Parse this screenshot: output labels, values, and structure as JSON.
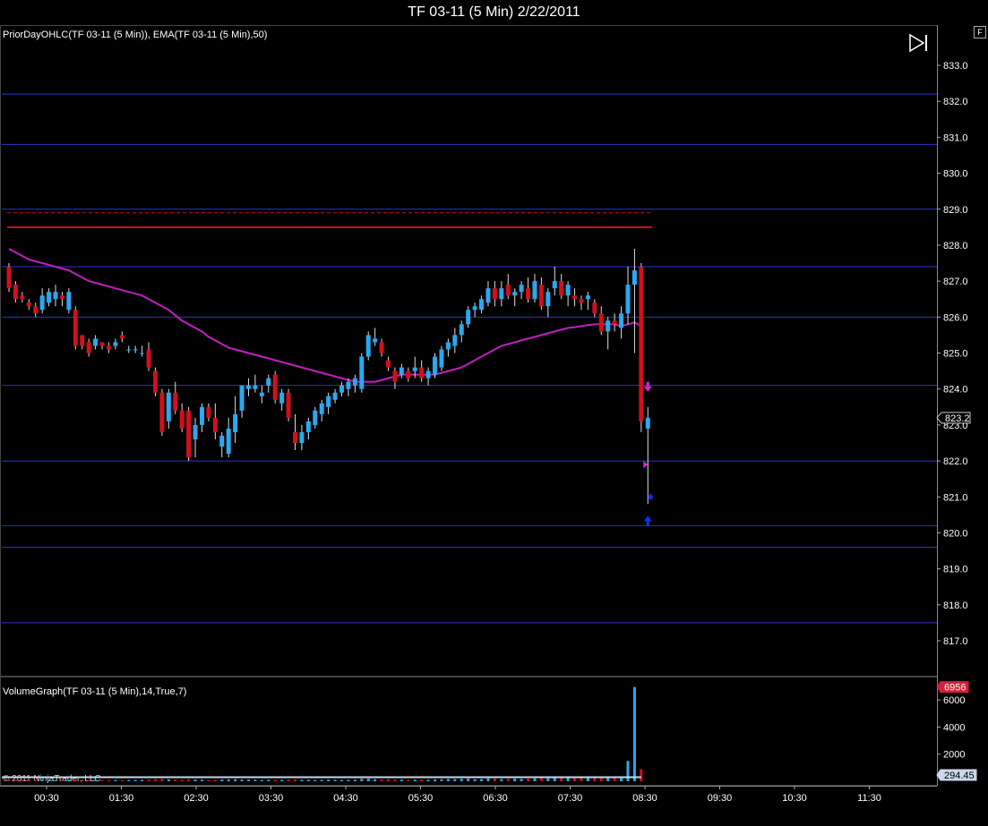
{
  "title": "TF 03-11 (5 Min)  2/22/2011",
  "price_panel_label": "PriorDayOHLC(TF 03-11 (5 Min)), EMA(TF 03-11 (5 Min),50)",
  "volume_panel_label": "VolumeGraph(TF 03-11 (5 Min),14,True,7)",
  "copyright": "© 2011 NinjaTrader, LLC",
  "f_button": "F",
  "colors": {
    "up": "#2aa8f0",
    "down": "#d0101c",
    "ema": "#c020c0",
    "hline": "#2a36c8",
    "prior_day": "#d41010",
    "axis_text": "#ffffff",
    "marker_magenta": "#e020e0",
    "marker_blue": "#1030f0"
  },
  "chart_data": [
    {
      "type": "candlestick",
      "panel": "price",
      "yaxis": {
        "min": 816.0,
        "max": 833.5,
        "ticks": [
          "833.0",
          "832.0",
          "831.0",
          "830.0",
          "829.0",
          "828.0",
          "827.0",
          "826.0",
          "825.0",
          "824.0",
          "823.0",
          "822.0",
          "821.0",
          "820.0",
          "819.0",
          "818.0",
          "817.0"
        ]
      },
      "xaxis": {
        "ticks": [
          "00:30",
          "01:30",
          "02:30",
          "03:30",
          "04:30",
          "05:30",
          "06:30",
          "07:30",
          "08:30",
          "09:30",
          "10:30",
          "11:30"
        ]
      },
      "last_price": "823.2",
      "horizontal_lines": [
        832.2,
        830.8,
        829.0,
        827.4,
        826.0,
        824.1,
        822.0,
        820.2,
        819.6,
        817.5
      ],
      "prior_day_lines": [
        {
          "y": 828.9,
          "style": "dashed"
        },
        {
          "y": 828.5,
          "style": "solid"
        }
      ],
      "candles": [
        [
          827.4,
          827.5,
          826.7,
          826.8
        ],
        [
          826.9,
          827.0,
          826.4,
          826.5
        ],
        [
          826.6,
          826.7,
          826.4,
          826.5
        ],
        [
          826.4,
          826.5,
          826.2,
          826.3
        ],
        [
          826.3,
          826.4,
          826.0,
          826.1
        ],
        [
          826.2,
          826.8,
          826.1,
          826.6
        ],
        [
          826.4,
          826.8,
          826.3,
          826.7
        ],
        [
          826.5,
          826.9,
          826.3,
          826.7
        ],
        [
          826.6,
          826.7,
          826.3,
          826.5
        ],
        [
          826.2,
          826.8,
          826.1,
          826.7
        ],
        [
          826.2,
          826.3,
          825.1,
          825.2
        ],
        [
          825.5,
          825.5,
          825.1,
          825.2
        ],
        [
          825.3,
          825.4,
          824.9,
          825.0
        ],
        [
          825.2,
          825.5,
          825.1,
          825.4
        ],
        [
          825.3,
          825.3,
          825.1,
          825.2
        ],
        [
          825.2,
          825.3,
          825.0,
          825.1
        ],
        [
          825.2,
          825.4,
          825.1,
          825.3
        ],
        [
          825.5,
          825.6,
          825.3,
          825.4
        ],
        [
          825.1,
          825.2,
          825.0,
          825.1
        ],
        [
          825.1,
          825.2,
          825.0,
          825.1
        ],
        [
          825.0,
          825.2,
          824.9,
          825.0
        ],
        [
          825.1,
          825.3,
          824.5,
          824.6
        ],
        [
          824.5,
          824.6,
          823.8,
          823.9
        ],
        [
          823.9,
          824.0,
          822.7,
          822.8
        ],
        [
          823.1,
          824.0,
          822.9,
          823.9
        ],
        [
          823.9,
          824.2,
          823.3,
          823.4
        ],
        [
          823.4,
          823.6,
          822.8,
          822.9
        ],
        [
          823.4,
          823.5,
          822.0,
          822.1
        ],
        [
          822.6,
          823.2,
          822.1,
          823.0
        ],
        [
          823.0,
          823.6,
          822.8,
          823.5
        ],
        [
          823.5,
          823.6,
          823.1,
          823.2
        ],
        [
          823.2,
          823.6,
          822.6,
          822.8
        ],
        [
          822.4,
          822.8,
          822.1,
          822.7
        ],
        [
          822.2,
          823.2,
          822.1,
          822.9
        ],
        [
          822.8,
          823.8,
          822.5,
          823.3
        ],
        [
          823.4,
          824.1,
          823.2,
          824.1
        ],
        [
          824.0,
          824.3,
          823.8,
          824.1
        ],
        [
          824.0,
          824.4,
          823.9,
          824.1
        ],
        [
          823.8,
          824.1,
          823.6,
          823.9
        ],
        [
          824.1,
          824.4,
          823.9,
          824.3
        ],
        [
          824.4,
          824.5,
          823.6,
          823.7
        ],
        [
          823.6,
          824.0,
          823.4,
          823.9
        ],
        [
          823.9,
          824.0,
          823.1,
          823.2
        ],
        [
          822.8,
          823.3,
          822.3,
          822.5
        ],
        [
          822.5,
          823.0,
          822.3,
          822.8
        ],
        [
          822.8,
          823.2,
          822.6,
          823.1
        ],
        [
          823.0,
          823.5,
          822.9,
          823.4
        ],
        [
          823.3,
          823.7,
          823.1,
          823.6
        ],
        [
          823.5,
          823.9,
          823.3,
          823.8
        ],
        [
          823.7,
          824.0,
          823.6,
          823.9
        ],
        [
          823.9,
          824.2,
          823.8,
          824.1
        ],
        [
          824.0,
          824.3,
          823.8,
          824.2
        ],
        [
          824.1,
          824.4,
          823.9,
          824.3
        ],
        [
          824.0,
          825.0,
          823.9,
          824.9
        ],
        [
          824.9,
          825.6,
          824.8,
          825.5
        ],
        [
          825.3,
          825.7,
          825.2,
          825.4
        ],
        [
          825.3,
          825.4,
          824.9,
          825.0
        ],
        [
          824.8,
          824.9,
          824.5,
          824.6
        ],
        [
          824.5,
          824.6,
          824.0,
          824.2
        ],
        [
          824.4,
          824.7,
          824.3,
          824.6
        ],
        [
          824.5,
          824.6,
          824.2,
          824.3
        ],
        [
          824.5,
          824.9,
          824.3,
          824.6
        ],
        [
          824.6,
          824.8,
          824.2,
          824.3
        ],
        [
          824.3,
          824.6,
          824.1,
          824.5
        ],
        [
          824.4,
          825.0,
          824.3,
          824.9
        ],
        [
          824.6,
          825.2,
          824.5,
          825.1
        ],
        [
          825.1,
          825.4,
          824.9,
          825.3
        ],
        [
          825.2,
          825.7,
          825.0,
          825.5
        ],
        [
          825.5,
          825.9,
          825.3,
          825.8
        ],
        [
          825.8,
          826.3,
          825.7,
          826.2
        ],
        [
          826.2,
          826.4,
          826.0,
          826.3
        ],
        [
          826.2,
          826.6,
          826.1,
          826.5
        ],
        [
          826.4,
          827.0,
          826.3,
          826.8
        ],
        [
          826.8,
          827.0,
          826.3,
          826.5
        ],
        [
          826.5,
          827.0,
          826.3,
          826.8
        ],
        [
          826.9,
          827.2,
          826.5,
          826.6
        ],
        [
          826.6,
          826.8,
          826.3,
          826.7
        ],
        [
          826.7,
          827.0,
          826.5,
          826.9
        ],
        [
          826.8,
          827.1,
          826.4,
          826.5
        ],
        [
          826.5,
          827.2,
          826.4,
          827.0
        ],
        [
          826.9,
          827.1,
          826.2,
          826.3
        ],
        [
          826.3,
          826.8,
          826.0,
          826.7
        ],
        [
          826.8,
          827.4,
          826.6,
          827.0
        ],
        [
          827.0,
          827.2,
          826.5,
          826.6
        ],
        [
          826.6,
          827.0,
          826.3,
          826.9
        ],
        [
          826.6,
          826.8,
          826.3,
          826.5
        ],
        [
          826.5,
          826.6,
          826.2,
          826.4
        ],
        [
          826.5,
          826.7,
          826.2,
          826.6
        ],
        [
          826.4,
          826.5,
          826.0,
          826.1
        ],
        [
          826.1,
          826.3,
          825.5,
          825.6
        ],
        [
          825.6,
          826.0,
          825.1,
          825.9
        ],
        [
          825.9,
          826.1,
          825.6,
          825.8
        ],
        [
          825.7,
          826.3,
          825.4,
          826.1
        ],
        [
          826.1,
          827.4,
          825.8,
          826.9
        ],
        [
          826.9,
          827.9,
          825.0,
          827.3
        ],
        [
          827.4,
          827.5,
          822.8,
          823.1
        ],
        [
          822.9,
          823.5,
          820.8,
          823.2
        ]
      ],
      "ema": [
        827.9,
        827.8,
        827.7,
        827.6,
        827.55,
        827.5,
        827.45,
        827.4,
        827.35,
        827.3,
        827.2,
        827.1,
        827.0,
        826.95,
        826.9,
        826.85,
        826.8,
        826.75,
        826.7,
        826.65,
        826.6,
        826.5,
        826.4,
        826.3,
        826.2,
        826.05,
        825.9,
        825.8,
        825.7,
        825.6,
        825.45,
        825.35,
        825.25,
        825.15,
        825.1,
        825.05,
        825.0,
        824.95,
        824.9,
        824.85,
        824.8,
        824.75,
        824.7,
        824.65,
        824.6,
        824.55,
        824.5,
        824.45,
        824.4,
        824.35,
        824.3,
        824.25,
        824.2,
        824.2,
        824.2,
        824.2,
        824.25,
        824.3,
        824.35,
        824.4,
        824.4,
        824.4,
        824.4,
        824.4,
        824.4,
        824.45,
        824.5,
        824.55,
        824.6,
        824.7,
        824.8,
        824.9,
        825.0,
        825.1,
        825.2,
        825.25,
        825.3,
        825.35,
        825.4,
        825.45,
        825.5,
        825.55,
        825.6,
        825.65,
        825.7,
        825.72,
        825.75,
        825.78,
        825.8,
        825.8,
        825.8,
        825.8,
        825.75,
        825.8,
        825.85,
        825.75
      ],
      "markers": [
        {
          "type": "arrow-down",
          "y": 824.0,
          "color": "magenta"
        },
        {
          "type": "triangle-right",
          "y": 821.9,
          "color": "magenta"
        },
        {
          "type": "diamond",
          "y": 821.0,
          "color": "blue"
        },
        {
          "type": "arrow-up",
          "y": 820.4,
          "color": "blue"
        }
      ]
    },
    {
      "type": "bar",
      "panel": "volume",
      "yaxis": {
        "min": 0,
        "max": 7000,
        "ticks": [
          "6000",
          "4000",
          "2000"
        ]
      },
      "badges": {
        "max_volume": "6956",
        "average": "294.45"
      },
      "values": [
        120,
        110,
        100,
        90,
        100,
        110,
        95,
        90,
        100,
        110,
        150,
        120,
        100,
        100,
        90,
        95,
        100,
        90,
        95,
        100,
        110,
        130,
        160,
        170,
        140,
        130,
        120,
        150,
        130,
        120,
        110,
        120,
        130,
        140,
        150,
        130,
        120,
        110,
        100,
        110,
        120,
        110,
        130,
        140,
        120,
        110,
        100,
        110,
        120,
        110,
        100,
        110,
        120,
        180,
        200,
        150,
        140,
        160,
        130,
        120,
        110,
        120,
        130,
        120,
        140,
        150,
        170,
        160,
        180,
        200,
        150,
        160,
        220,
        200,
        160,
        180,
        200,
        170,
        190,
        210,
        240,
        220,
        260,
        230,
        250,
        220,
        240,
        230,
        260,
        300,
        280,
        270,
        320,
        1500,
        6956,
        900
      ],
      "average_line": 294.45
    }
  ]
}
